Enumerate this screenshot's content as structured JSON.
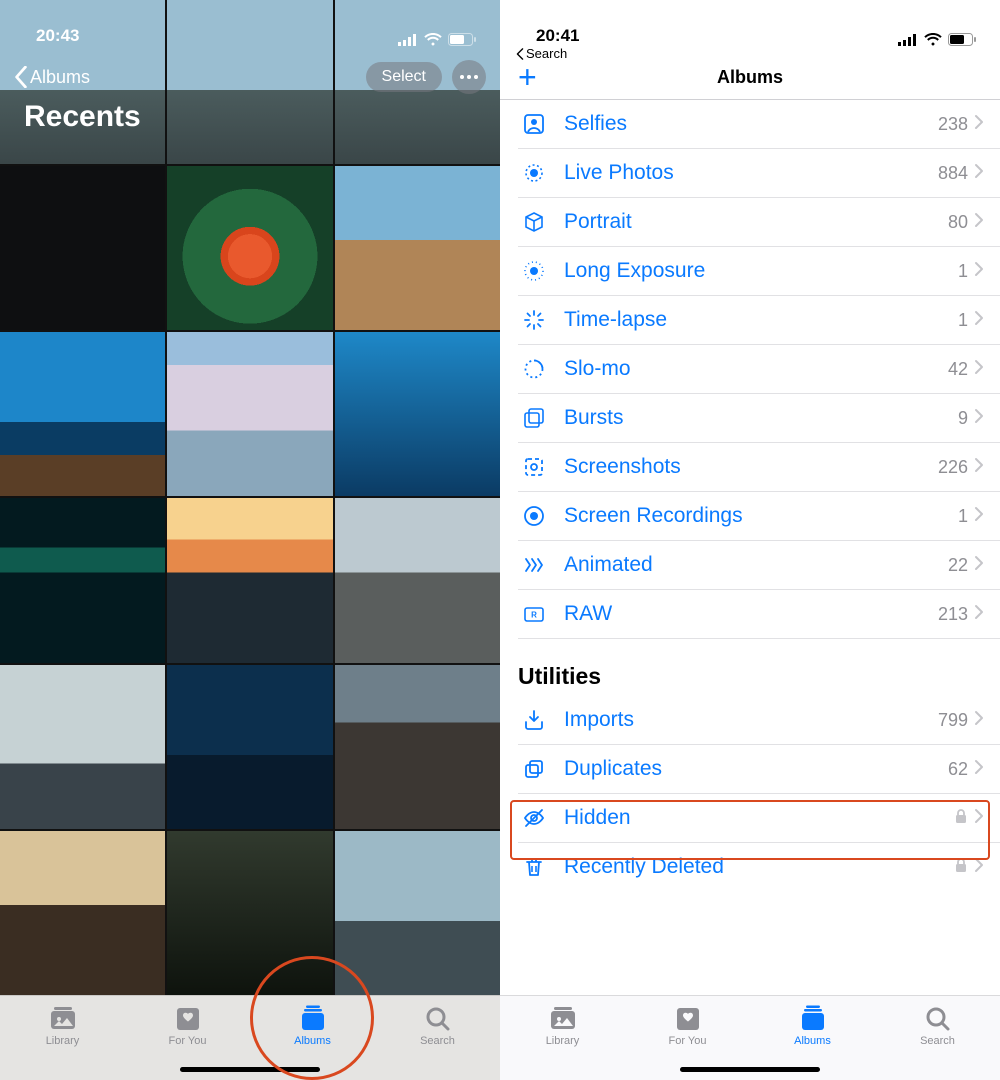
{
  "left": {
    "status": {
      "time": "20:43"
    },
    "back_label": "Albums",
    "title": "Recents",
    "select_label": "Select",
    "tabs": [
      {
        "label": "Library"
      },
      {
        "label": "For You"
      },
      {
        "label": "Albums"
      },
      {
        "label": "Search"
      }
    ]
  },
  "right": {
    "status": {
      "time": "20:41"
    },
    "back_search": "Search",
    "title": "Albums",
    "media_types": [
      {
        "icon": "person",
        "label": "Selfies",
        "count": "238"
      },
      {
        "icon": "livephoto",
        "label": "Live Photos",
        "count": "884"
      },
      {
        "icon": "cube",
        "label": "Portrait",
        "count": "80"
      },
      {
        "icon": "longexp",
        "label": "Long Exposure",
        "count": "1"
      },
      {
        "icon": "timelapse",
        "label": "Time-lapse",
        "count": "1"
      },
      {
        "icon": "slomo",
        "label": "Slo-mo",
        "count": "42"
      },
      {
        "icon": "bursts",
        "label": "Bursts",
        "count": "9"
      },
      {
        "icon": "screenshots",
        "label": "Screenshots",
        "count": "226"
      },
      {
        "icon": "screenrec",
        "label": "Screen Recordings",
        "count": "1"
      },
      {
        "icon": "animated",
        "label": "Animated",
        "count": "22"
      },
      {
        "icon": "raw",
        "label": "RAW",
        "count": "213"
      }
    ],
    "utilities_header": "Utilities",
    "utilities": [
      {
        "icon": "imports",
        "label": "Imports",
        "count": "799"
      },
      {
        "icon": "duplicates",
        "label": "Duplicates",
        "count": "62"
      },
      {
        "icon": "hidden",
        "label": "Hidden",
        "lock": true
      },
      {
        "icon": "trash",
        "label": "Recently Deleted",
        "lock": true
      }
    ],
    "tabs": [
      {
        "label": "Library"
      },
      {
        "label": "For You"
      },
      {
        "label": "Albums"
      },
      {
        "label": "Search"
      }
    ]
  },
  "colors": {
    "accent": "#0a7aff",
    "annotation": "#d9481f"
  }
}
